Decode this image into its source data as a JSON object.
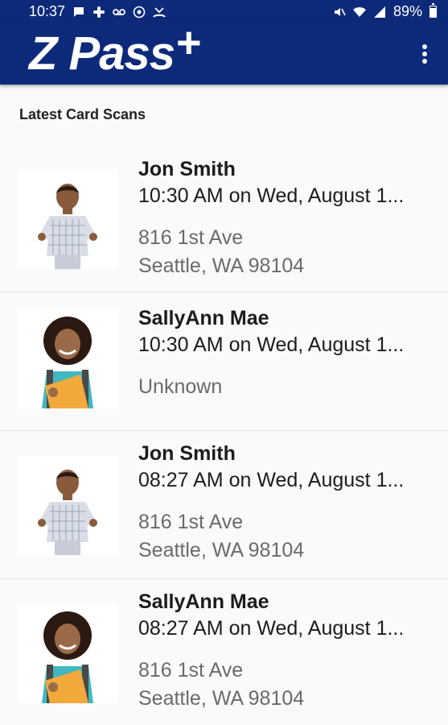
{
  "status_bar": {
    "time": "10:37",
    "battery": "89%",
    "left_icons": [
      "chat-icon",
      "slack-icon",
      "voicemail-icon",
      "radio-icon",
      "missed-call-icon"
    ],
    "right_icons": [
      "mute-icon",
      "wifi-icon",
      "signal-icon",
      "battery-icon"
    ]
  },
  "app_bar": {
    "logo_text": "Z Pass",
    "logo_plus": "+",
    "menu_icon": "more-vertical-icon",
    "color": "#0d2a7a"
  },
  "section": {
    "title": "Latest Card Scans"
  },
  "scans": [
    {
      "name": "Jon Smith",
      "time": "10:30 AM on Wed, August 1...",
      "address_line1": "816 1st Ave",
      "address_line2": "Seattle, WA 98104",
      "photo": "boy-photo"
    },
    {
      "name": "SallyAnn Mae",
      "time": "10:30 AM on Wed, August 1...",
      "address_line1": "Unknown",
      "address_line2": "",
      "photo": "girl-photo"
    },
    {
      "name": "Jon Smith",
      "time": "08:27 AM on Wed, August 1...",
      "address_line1": "816 1st Ave",
      "address_line2": "Seattle, WA 98104",
      "photo": "boy-photo"
    },
    {
      "name": "SallyAnn Mae",
      "time": "08:27 AM on Wed, August 1...",
      "address_line1": "816 1st Ave",
      "address_line2": "Seattle, WA 98104",
      "photo": "girl-photo"
    }
  ]
}
